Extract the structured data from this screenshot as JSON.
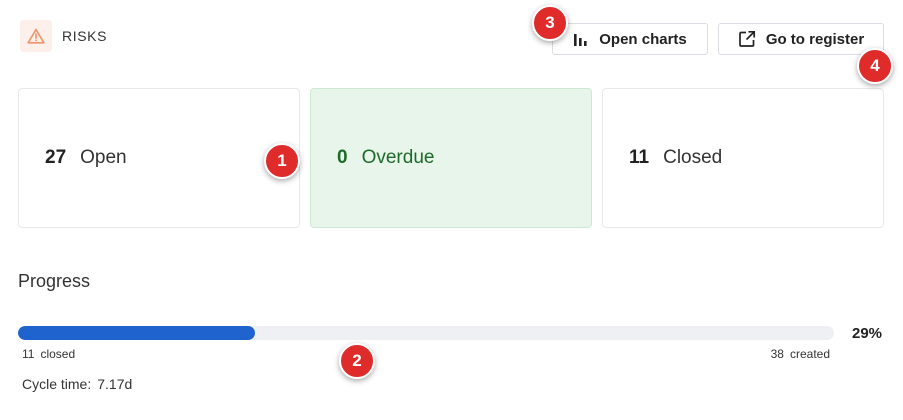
{
  "header": {
    "title": "RISKS",
    "icon": "warning-triangle-icon",
    "accent": "#f0936a"
  },
  "toolbar": {
    "charts_label": "Open charts",
    "charts_icon": "bar-chart-icon",
    "register_label": "Go to register",
    "register_icon": "external-link-icon"
  },
  "cards": {
    "open": {
      "count": "27",
      "label": "Open"
    },
    "overdue": {
      "count": "0",
      "label": "Overdue",
      "color": "#1e6a2a",
      "background": "#e7f5ea"
    },
    "closed": {
      "count": "11",
      "label": "Closed"
    }
  },
  "progress": {
    "title": "Progress",
    "percent_text": "29%",
    "fraction": 0.29,
    "closed_count": "11",
    "closed_label": "closed",
    "created_count": "38",
    "created_label": "created",
    "bar_color": "#1f63cf"
  },
  "cycle": {
    "label": "Cycle time:",
    "value": "7.17d"
  },
  "markers": [
    "1",
    "2",
    "3",
    "4"
  ]
}
